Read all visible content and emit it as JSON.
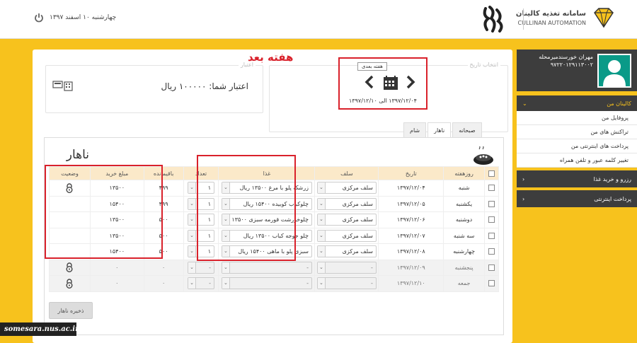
{
  "header": {
    "app_title_fa": "سامانه تغذیه کالینان",
    "app_title_en": "CULLINAN AUTOMATION",
    "date": "چهارشنبه ۱۰ اسفند ۱۳۹۷"
  },
  "profile": {
    "name": "مهران خورسندمیرمحله",
    "code": "۹۷۲۲۰۱۲۹۱۱۳۰۰۲"
  },
  "sidebar": {
    "section_title": "کالینان من",
    "items": [
      "پروفایل من",
      "تراکنش های من",
      "پرداخت های اینترنتی من",
      "تغییر کلمه عبور و تلفن همراه"
    ],
    "reserve_label": "رزرو و خرید غذا",
    "online_pay_label": "پرداخت اینترنتی"
  },
  "date_select": {
    "legend": "انتخاب تاریخ",
    "next_tooltip": "هفته بعدی",
    "range": "۱۳۹۷/۱۲/۰۴ الی ۱۳۹۷/۱۲/۱۰"
  },
  "credit": {
    "legend": "اعتبار",
    "text": "اعتبار شما: ۱۰۰۰۰۰ ریال"
  },
  "annotation": "هفته بعد",
  "tabs": [
    "صبحانه",
    "ناهار",
    "شام"
  ],
  "active_tab": 1,
  "panel_title": "ناهار",
  "table": {
    "headers": {
      "day": "روزهفته",
      "date": "تاریخ",
      "salf": "سلف",
      "food": "غذا",
      "count": "تعداد",
      "remaining": "باقیمانده",
      "price": "مبلغ خرید",
      "status": "وضعیت"
    },
    "rows": [
      {
        "day": "شنبه",
        "date": "۱۳۹۷/۱۲/۰۴",
        "salf": "سلف مرکزی",
        "food": "زرشک پلو با مرغ ۱۳۵۰۰ ریال",
        "count": "۱",
        "remaining": "۴۹۹",
        "price": "۱۳۵۰۰",
        "locked": true,
        "disabled": false
      },
      {
        "day": "یکشنبه",
        "date": "۱۳۹۷/۱۲/۰۵",
        "salf": "سلف مرکزی",
        "food": "چلوکباب کوبیده ۱۵۴۰۰ ریال",
        "count": "۱",
        "remaining": "۴۹۹",
        "price": "۱۵۴۰۰",
        "locked": false,
        "disabled": false
      },
      {
        "day": "دوشنبه",
        "date": "۱۳۹۷/۱۲/۰۶",
        "salf": "سلف مرکزی",
        "food": "چلوخورشت قورمه سبزی ۱۳۵۰۰",
        "count": "۱",
        "remaining": "۵۰۰",
        "price": "۱۳۵۰۰",
        "locked": false,
        "disabled": false
      },
      {
        "day": "سه شنبه",
        "date": "۱۳۹۷/۱۲/۰۷",
        "salf": "سلف مرکزی",
        "food": "چلو جوجه کباب ۱۳۵۰۰ ریال",
        "count": "۱",
        "remaining": "۵۰۰",
        "price": "۱۳۵۰۰",
        "locked": false,
        "disabled": false
      },
      {
        "day": "چهارشنبه",
        "date": "۱۳۹۷/۱۲/۰۸",
        "salf": "سلف مرکزی",
        "food": "سبزی پلو با ماهی ۱۵۴۰۰ ریال",
        "count": "۱",
        "remaining": "۵۰۰",
        "price": "۱۵۴۰۰",
        "locked": false,
        "disabled": false
      },
      {
        "day": "پنجشنبه",
        "date": "۱۳۹۷/۱۲/۰۹",
        "salf": "-",
        "food": "-",
        "count": "-",
        "remaining": "۰",
        "price": "۰",
        "locked": true,
        "disabled": true
      },
      {
        "day": "جمعه",
        "date": "۱۳۹۷/۱۲/۱۰",
        "salf": "-",
        "food": "-",
        "count": "-",
        "remaining": "۰",
        "price": "۰",
        "locked": true,
        "disabled": true
      }
    ]
  },
  "save_label": "ذخیره ناهار",
  "watermark": "somesara.nus.ac.ir"
}
